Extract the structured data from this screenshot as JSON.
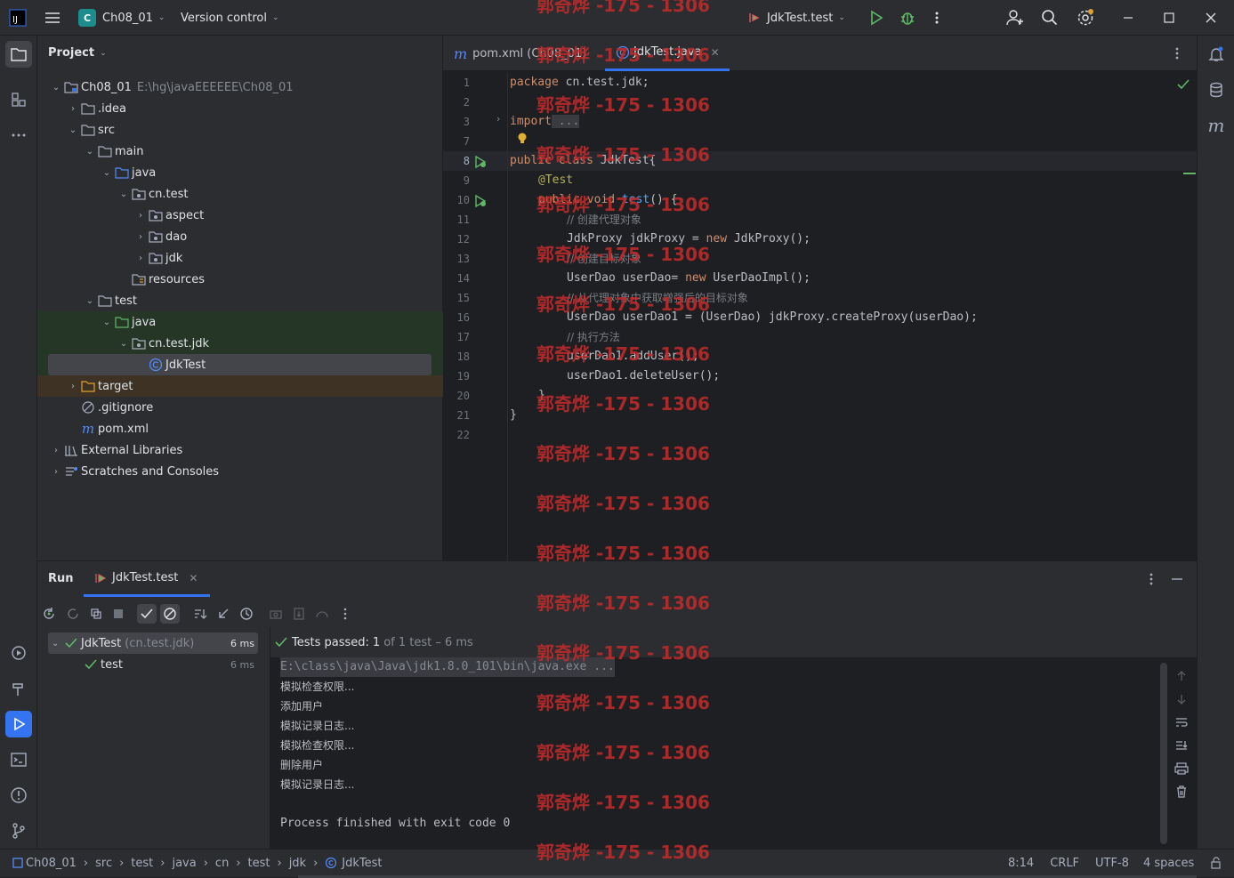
{
  "titlebar": {
    "project_badge": "C",
    "project_name": "Ch08_01",
    "vcs": "Version control",
    "run_config": "JdkTest.test"
  },
  "project_panel": {
    "title": "Project",
    "tree": [
      {
        "label": "Ch08_01",
        "extra": "E:\\hg\\javaEEEEEE\\Ch08_01"
      },
      {
        "label": ".idea"
      },
      {
        "label": "src"
      },
      {
        "label": "main"
      },
      {
        "label": "java"
      },
      {
        "label": "cn.test"
      },
      {
        "label": "aspect"
      },
      {
        "label": "dao"
      },
      {
        "label": "jdk"
      },
      {
        "label": "resources"
      },
      {
        "label": "test"
      },
      {
        "label": "java"
      },
      {
        "label": "cn.test.jdk"
      },
      {
        "label": "JdkTest"
      },
      {
        "label": "target"
      },
      {
        "label": ".gitignore"
      },
      {
        "label": "pom.xml"
      },
      {
        "label": "External Libraries"
      },
      {
        "label": "Scratches and Consoles"
      }
    ]
  },
  "editor": {
    "tabs": [
      {
        "label": "pom.xml (Ch08_01)"
      },
      {
        "label": "JdkTest.java"
      }
    ],
    "line_numbers": [
      "1",
      "2",
      "3",
      "7",
      "8",
      "9",
      "10",
      "11",
      "12",
      "13",
      "14",
      "15",
      "16",
      "17",
      "18",
      "19",
      "20",
      "21",
      "22"
    ],
    "code": {
      "l1_kw": "package",
      "l1_rest": " cn.test.jdk;",
      "l3_kw": "import",
      "l3_rest": " ...",
      "l8_kw": "public class",
      "l8_rest": " JdkTest{",
      "l9": "@Test",
      "l10_kw": "public void",
      "l10_fn": " test",
      "l10_rest": "() {",
      "l11": "// 创建代理对象",
      "l12_a": "JdkProxy jdkProxy = ",
      "l12_kw": "new",
      "l12_b": " JdkProxy();",
      "l13": "// 创建目标对象",
      "l14_a": "UserDao userDao= ",
      "l14_kw": "new",
      "l14_b": " UserDaoImpl();",
      "l15": "// 从代理对象中获取增强后的目标对象",
      "l16": "UserDao userDao1 = (UserDao) jdkProxy.createProxy(userDao);",
      "l17": "// 执行方法",
      "l18": "userDao1.addUser();",
      "l19": "userDao1.deleteUser();",
      "l20": "}",
      "l21": "}"
    }
  },
  "run_panel": {
    "title": "Run",
    "tab": "JdkTest.test",
    "tests": [
      {
        "name": "JdkTest",
        "pkg": "(cn.test.jdk)",
        "time": "6 ms"
      },
      {
        "name": "test",
        "time": "6 ms"
      }
    ],
    "status_prefix": "Tests passed:",
    "status_count": "1",
    "status_suffix": "of 1 test – 6 ms",
    "console": [
      "E:\\class\\java\\Java\\jdk1.8.0_101\\bin\\java.exe ...",
      "模拟检查权限...",
      "添加用户",
      "模拟记录日志...",
      "模拟检查权限...",
      "删除用户",
      "模拟记录日志...",
      "",
      "Process finished with exit code 0"
    ]
  },
  "statusbar": {
    "breadcrumb": [
      "Ch08_01",
      "src",
      "test",
      "java",
      "cn",
      "test",
      "jdk",
      "JdkTest"
    ],
    "position": "8:14",
    "line_sep": "CRLF",
    "encoding": "UTF-8",
    "indent": "4 spaces"
  },
  "watermark": "郭奇烨 -175 - 1306",
  "colors": {
    "accent": "#3574f0",
    "pass": "#5fb865",
    "keyword": "#cf8e6d",
    "watermark": "#c42b2b"
  }
}
